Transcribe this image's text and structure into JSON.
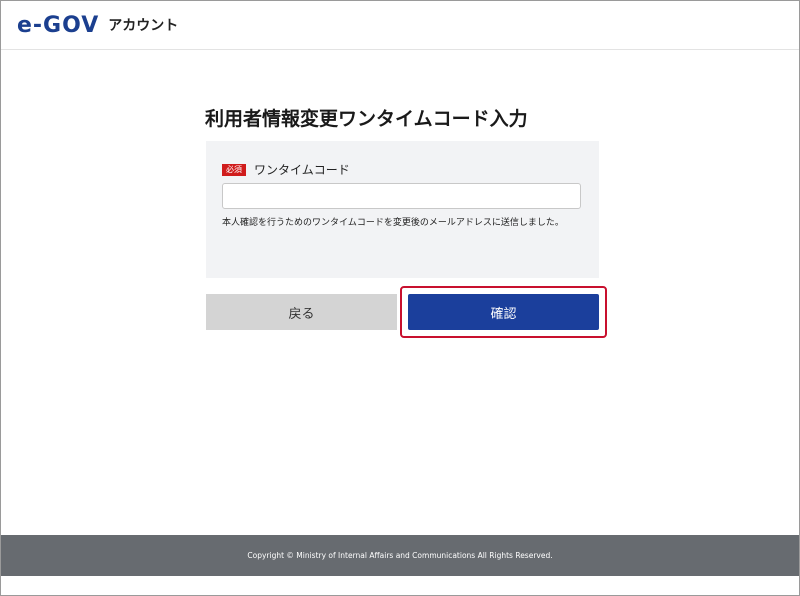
{
  "header": {
    "logo_text": "e-GOV",
    "logo_sub": "アカウント"
  },
  "main": {
    "title": "利用者情報変更ワンタイムコード入力",
    "field": {
      "required_badge": "必須",
      "label": "ワンタイムコード",
      "value": "",
      "placeholder": "",
      "help_text": "本人確認を行うためのワンタイムコードを変更後のメールアドレスに送信しました。"
    },
    "buttons": {
      "back_label": "戻る",
      "confirm_label": "確認"
    }
  },
  "footer": {
    "copyright": "Copyright © Ministry of Internal Affairs and Communications All Rights Reserved."
  },
  "colors": {
    "brand_blue": "#1b3f9c",
    "required_red": "#d01c1c",
    "highlight_red": "#c8102e",
    "footer_gray": "#676b70"
  }
}
